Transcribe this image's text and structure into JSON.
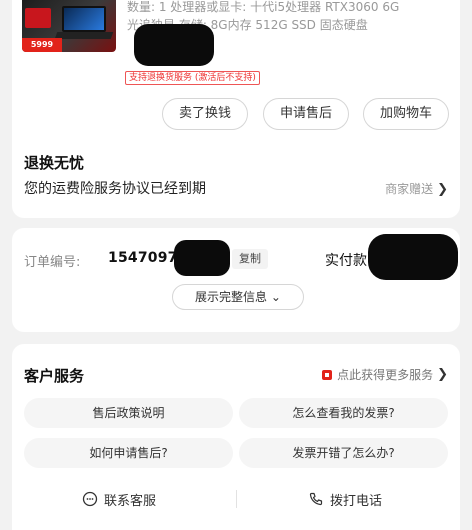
{
  "product": {
    "price_tag": "5999",
    "spec_line_1": "数量: 1  处理器或显卡: 十代i5处理器 RTX3060 6G",
    "spec_line_2": "光追独显  存储: 8G内存 512G SSD 固态硬盘",
    "support_badge": "支持退换货服务 (激活后不支持)"
  },
  "actions": {
    "sell": "卖了换钱",
    "aftersale": "申请售后",
    "cart": "加购物车"
  },
  "return_worry_free": {
    "title": "退换无忧",
    "notice": "您的运费险服务协议已经到期",
    "merchant_gift": "商家赠送"
  },
  "order": {
    "number_label": "订单编号:",
    "number_value": "154709752",
    "copy_label": "复制",
    "paid_label": "实付款",
    "expand_label": "展示完整信息"
  },
  "service": {
    "title": "客户服务",
    "more_link": "点此获得更多服务",
    "faqs": [
      "售后政策说明",
      "怎么查看我的发票?",
      "如何申请售后?",
      "发票开错了怎么办?"
    ],
    "contact_chat": "联系客服",
    "contact_call": "拨打电话"
  },
  "colors": {
    "accent_red": "#e2231a",
    "muted_text": "#999999",
    "background": "#f2f2f2"
  },
  "icons": [
    "chevron-right-icon",
    "chevron-down-icon",
    "gift-icon",
    "chat-icon",
    "phone-icon"
  ]
}
